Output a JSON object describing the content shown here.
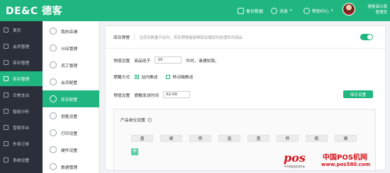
{
  "topbar": {
    "logo": "DE&C 德客",
    "items": [
      {
        "label": "备份数据",
        "icon": "backup-icon"
      },
      {
        "label": "消息",
        "icon": "bell-icon"
      },
      {
        "label": "帮助中心",
        "icon": "help-icon"
      }
    ],
    "user": {
      "name": "德客演示版",
      "role": "管理员"
    },
    "accent": "#1fb67f"
  },
  "leftnav": {
    "items": [
      {
        "label": "首页",
        "icon": "home-icon"
      },
      {
        "label": "会员管理",
        "icon": "member-icon"
      },
      {
        "label": "库存管理",
        "icon": "stock-icon"
      },
      {
        "label": "库存管理",
        "icon": "inventory-icon",
        "active": true
      },
      {
        "label": "日常支出",
        "icon": "expense-icon"
      },
      {
        "label": "智能分析",
        "icon": "analysis-icon"
      },
      {
        "label": "营销平台",
        "icon": "marketing-icon"
      },
      {
        "label": "外卖订单",
        "icon": "takeout-icon"
      },
      {
        "label": "系统设置",
        "icon": "settings-icon"
      }
    ]
  },
  "subnav": {
    "items": [
      {
        "label": "我的店铺",
        "icon": "shop-icon"
      },
      {
        "label": "分店管理",
        "icon": "branch-icon"
      },
      {
        "label": "员工管理",
        "icon": "staff-icon"
      },
      {
        "label": "会员配置",
        "icon": "member-config-icon"
      },
      {
        "label": "库存配置",
        "icon": "stock-config-icon",
        "active": true
      },
      {
        "label": "销售设置",
        "icon": "sales-icon"
      },
      {
        "label": "打印设置",
        "icon": "print-icon"
      },
      {
        "label": "硬件设置",
        "icon": "hardware-icon"
      },
      {
        "label": "数据管理",
        "icon": "data-icon"
      }
    ]
  },
  "content": {
    "stock_alert": {
      "label": "库存预警",
      "hint": "当库存数量不足时，库存预警能够帮助店铺及时处理库存商品",
      "enabled": true
    },
    "threshold": {
      "label": "预值设置",
      "prefix": "商品低于",
      "value": "10",
      "suffix": "件时，请通知我。"
    },
    "remind": {
      "label": "提醒方式",
      "options": [
        {
          "label": "站内推送",
          "checked": true
        },
        {
          "label": "移动端推送",
          "checked": false
        }
      ]
    },
    "time": {
      "label": "预值设置",
      "prefix": "提醒发送时间",
      "value": "02:00"
    },
    "save_label": "保存设置",
    "unit": {
      "title": "产品单位设置",
      "chips": [
        "盘",
        "碗",
        "例",
        "盅",
        "壶",
        "杯",
        "瓶",
        "碟"
      ],
      "add_label": "+"
    }
  },
  "watermark": {
    "brand": "pos",
    "tagline": "POS机信息交流平台",
    "cn": "中国POS机网",
    "url": "www.pos580.com"
  }
}
